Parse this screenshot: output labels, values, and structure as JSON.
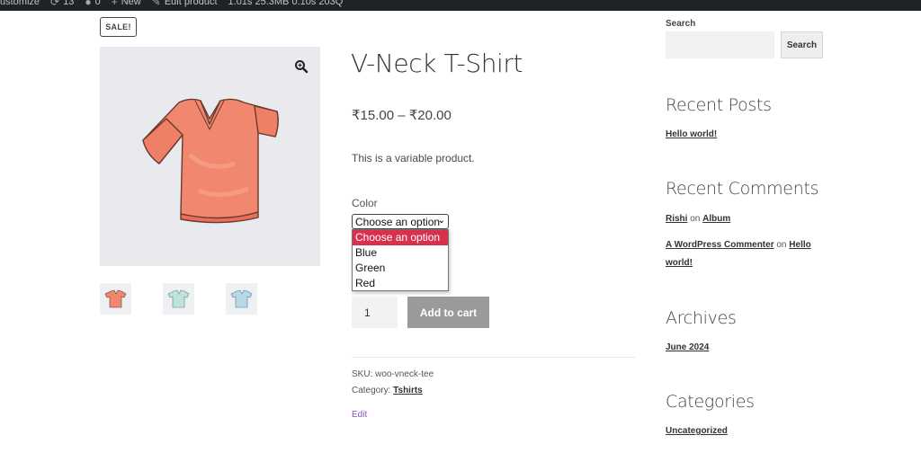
{
  "admin_bar": {
    "items": [
      "ustomize",
      "13",
      "0",
      "New",
      "Edit product",
      "1.01s 25.3MB 0.10s 203Q"
    ]
  },
  "product": {
    "sale_badge": "SALE!",
    "title": "V-Neck T-Shirt",
    "price": "₹15.00 – ₹20.00",
    "short_description": "This is a variable product.",
    "variation_label": "Color",
    "select_value": "Choose an option",
    "options": [
      "Choose an option",
      "Blue",
      "Green",
      "Red"
    ],
    "quantity": "1",
    "add_to_cart_label": "Add to cart",
    "sku_label": "SKU:",
    "sku": "woo-vneck-tee",
    "category_label": "Category:",
    "category": "Tshirts",
    "edit_label": "Edit",
    "thumbnail_colors": [
      "#f0876e",
      "#bfe3d8",
      "#b7d9e6"
    ]
  },
  "sidebar": {
    "search": {
      "label": "Search",
      "button": "Search",
      "placeholder": ""
    },
    "recent_posts": {
      "heading": "Recent Posts",
      "items": [
        "Hello world!"
      ]
    },
    "recent_comments": {
      "heading": "Recent Comments",
      "items": [
        {
          "author": "Rishi",
          "on": "on",
          "post": "Album"
        },
        {
          "author": "A WordPress Commenter",
          "on": "on",
          "post": "Hello world!"
        }
      ]
    },
    "archives": {
      "heading": "Archives",
      "items": [
        "June 2024"
      ]
    },
    "categories": {
      "heading": "Categories",
      "items": [
        "Uncategorized"
      ]
    }
  },
  "colors": {
    "admin_bar": "#1d2327",
    "dropdown_highlight": "#d9304e",
    "button_disabled": "#9a9a9a",
    "edit_link": "#7f54b3",
    "shirt": "#f0876e"
  }
}
